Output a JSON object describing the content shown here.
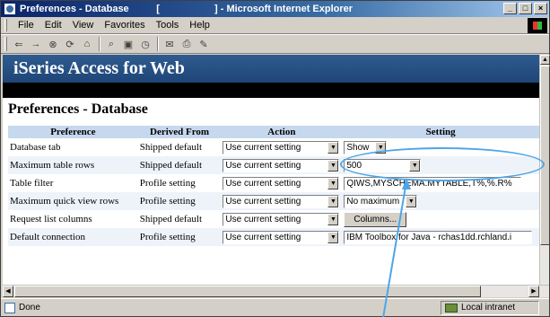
{
  "window": {
    "title": "Preferences - Database          [                    ] - Microsoft Internet Explorer",
    "controls": [
      "_",
      "□",
      "×"
    ]
  },
  "menu": [
    "File",
    "Edit",
    "View",
    "Favorites",
    "Tools",
    "Help"
  ],
  "toolbar": {
    "icons": [
      "back-icon",
      "forward-icon",
      "stop-icon",
      "refresh-icon",
      "home-icon",
      "search-icon",
      "favorites-icon",
      "history-icon",
      "mail-icon",
      "print-icon",
      "edit-icon"
    ]
  },
  "banner": {
    "title": "iSeries Access for Web"
  },
  "page": {
    "title": "Preferences - Database"
  },
  "table": {
    "headers": [
      "Preference",
      "Derived From",
      "Action",
      "Setting"
    ],
    "rows": [
      {
        "preference": "Database tab",
        "derived": "Shipped default",
        "action": "Use current setting",
        "setting_type": "select",
        "setting": "Show"
      },
      {
        "preference": "Maximum table rows",
        "derived": "Shipped default",
        "action": "Use current setting",
        "setting_type": "select",
        "setting": "500"
      },
      {
        "preference": "Table filter",
        "derived": "Profile setting",
        "action": "Use current setting",
        "setting_type": "text",
        "setting": "QIWS,MYSCHEMA.MYTABLE,T%,%.R%"
      },
      {
        "preference": "Maximum quick view rows",
        "derived": "Profile setting",
        "action": "Use current setting",
        "setting_type": "select",
        "setting": "No maximum"
      },
      {
        "preference": "Request list columns",
        "derived": "Shipped default",
        "action": "Use current setting",
        "setting_type": "button",
        "setting": "Columns..."
      },
      {
        "preference": "Default connection",
        "derived": "Profile setting",
        "action": "Use current setting",
        "setting_type": "select",
        "setting": "IBM Toolbox for Java - rchas1dd.rchland.i"
      }
    ]
  },
  "status": {
    "left": "Done",
    "zone": "Local intranet"
  },
  "colors": {
    "banner": "#1f4578",
    "header_row": "#c6d8ee",
    "callout": "#4da6e8"
  }
}
